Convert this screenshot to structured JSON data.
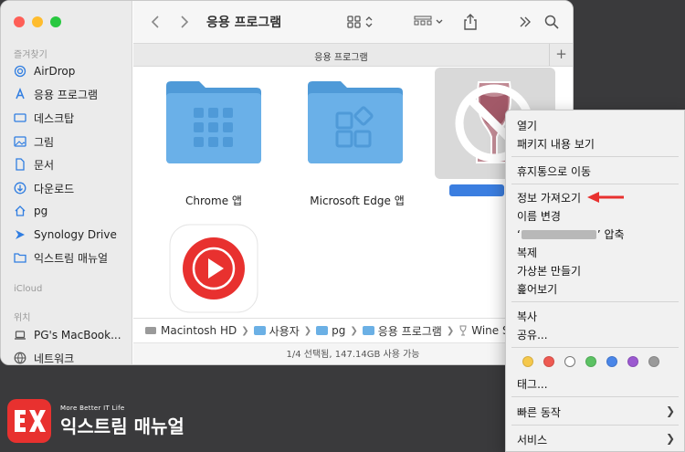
{
  "sidebar": {
    "section_favorites": "즐겨찾기",
    "favorites": [
      {
        "label": "AirDrop",
        "icon": "airdrop-icon"
      },
      {
        "label": "응용 프로그램",
        "icon": "applications-icon"
      },
      {
        "label": "데스크탑",
        "icon": "desktop-icon"
      },
      {
        "label": "그림",
        "icon": "pictures-icon"
      },
      {
        "label": "문서",
        "icon": "document-icon"
      },
      {
        "label": "다운로드",
        "icon": "download-icon"
      },
      {
        "label": "pg",
        "icon": "home-icon"
      },
      {
        "label": "Synology Drive",
        "icon": "synology-drive-icon"
      },
      {
        "label": "익스트림 매뉴얼",
        "icon": "folder-icon"
      }
    ],
    "section_icloud": "iCloud",
    "section_locations": "위치",
    "locations": [
      {
        "label": "PG's MacBook...",
        "icon": "laptop-icon"
      },
      {
        "label": "네트워크",
        "icon": "network-icon"
      }
    ]
  },
  "toolbar": {
    "title": "응용 프로그램"
  },
  "tab": {
    "label": "응용 프로그램",
    "plus": "+"
  },
  "files": [
    {
      "name": "Chrome 앱",
      "icon": "folder-apps-icon"
    },
    {
      "name": "Microsoft Edge 앱",
      "icon": "folder-apps-icon"
    },
    {
      "name": "",
      "icon": "wine-stable-app-icon",
      "selected": true
    },
    {
      "name": "",
      "icon": "youtube-music-app-icon"
    }
  ],
  "pathbar": [
    "Macintosh HD",
    "사용자",
    "pg",
    "응용 프로그램",
    "Wine Stab"
  ],
  "status": "1/4 선택됨, 147.14GB 사용 가능",
  "context_menu": {
    "items": [
      {
        "label": "열기"
      },
      {
        "label": "패키지 내용 보기"
      },
      {
        "label": "휴지통으로 이동"
      },
      {
        "label": "정보 가져오기"
      },
      {
        "label": "이름 변경"
      },
      {
        "label": "‘",
        "suffix": "’ 압축"
      },
      {
        "label": "복제"
      },
      {
        "label": "가상본 만들기"
      },
      {
        "label": "훑어보기"
      },
      {
        "label": "복사"
      },
      {
        "label": "공유..."
      },
      {
        "label": "태그..."
      },
      {
        "label": "빠른 동작",
        "submenu": true
      },
      {
        "label": "서비스",
        "submenu": true
      }
    ],
    "tag_colors": [
      "#f5c84c",
      "#ee5a52",
      "#ffffff",
      "#5cc264",
      "#4a86e8",
      "#9b59d0",
      "#9a9a9a"
    ],
    "arrow_color": "#e8312f"
  },
  "logo": {
    "badge": "EX",
    "tagline": "More Better IT Life",
    "name": "익스트림 매뉴얼"
  },
  "colors": {
    "folder": "#6ab0e8",
    "folder_dark": "#4f9ad8",
    "selection": "#3b7ee0",
    "traffic_red": "#fe5f57",
    "traffic_yellow": "#febc2e",
    "traffic_green": "#28c840"
  }
}
